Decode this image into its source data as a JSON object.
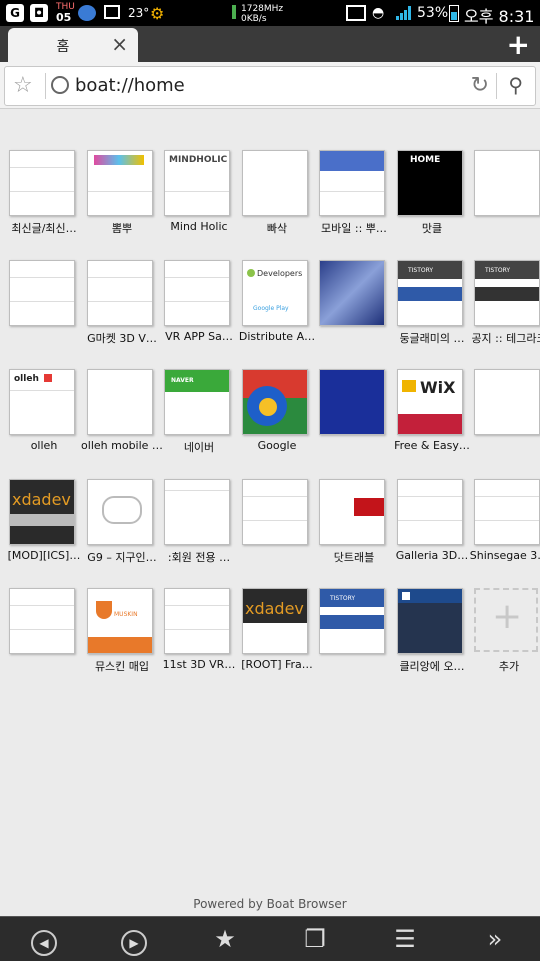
{
  "status_bar": {
    "day": "THU",
    "date": "05",
    "temperature": "23°",
    "cpu": "1728MHz",
    "net": "0KB/s",
    "battery": "53%",
    "time": "오후 8:31"
  },
  "tab": {
    "title": "홈"
  },
  "address_bar": {
    "url": "boat://home"
  },
  "colors": {
    "accent_blue": "#2f5aa8",
    "green": "#3aa93a",
    "dark": "#2c2c2c"
  },
  "tiles": [
    {
      "label": "최신글/최신…"
    },
    {
      "label": "뽐뿌"
    },
    {
      "label": "Mind Holic"
    },
    {
      "label": "빠삭"
    },
    {
      "label": "모바일 :: 뿌…"
    },
    {
      "label": "맛클"
    },
    {
      "label": ""
    },
    {
      "label": ""
    },
    {
      "label": "G마켓 3D V…"
    },
    {
      "label": "VR APP Sa…"
    },
    {
      "label": "Distribute A…"
    },
    {
      "label": ""
    },
    {
      "label": "둥글래미의 …"
    },
    {
      "label": "공지 :: 테그라크"
    },
    {
      "label": "olleh"
    },
    {
      "label": "olleh mobile …"
    },
    {
      "label": "네이버"
    },
    {
      "label": "Google"
    },
    {
      "label": ""
    },
    {
      "label": "Free & Easy…"
    },
    {
      "label": ""
    },
    {
      "label": "[MOD][ICS]…"
    },
    {
      "label": "G9 – 지구인…"
    },
    {
      "label": ":회원 전용 …"
    },
    {
      "label": ""
    },
    {
      "label": "닷트래블"
    },
    {
      "label": "Galleria 3D…"
    },
    {
      "label": "Shinsegae 3…"
    },
    {
      "label": ""
    },
    {
      "label": "뮤스킨 매입"
    },
    {
      "label": "11st 3D VR…"
    },
    {
      "label": "[ROOT] Fra…"
    },
    {
      "label": ""
    },
    {
      "label": "클리앙에 오…"
    },
    {
      "label": "추가"
    }
  ],
  "thumb_text": {
    "mindholic": "MINDHOLIC",
    "home": "HOME",
    "developers": "Developers",
    "google_play": "Google Play",
    "tistory": "TISTORY",
    "olleh": "olleh",
    "naver": "NAVER",
    "wix": "WiX",
    "xda": "xdadev",
    "musking": "MUSKIN"
  },
  "footer": {
    "powered_by": "Powered by Boat Browser"
  },
  "icons": [
    "back-icon",
    "forward-icon",
    "bookmark-star-icon",
    "tabs-icon",
    "menu-icon",
    "more-icon"
  ]
}
